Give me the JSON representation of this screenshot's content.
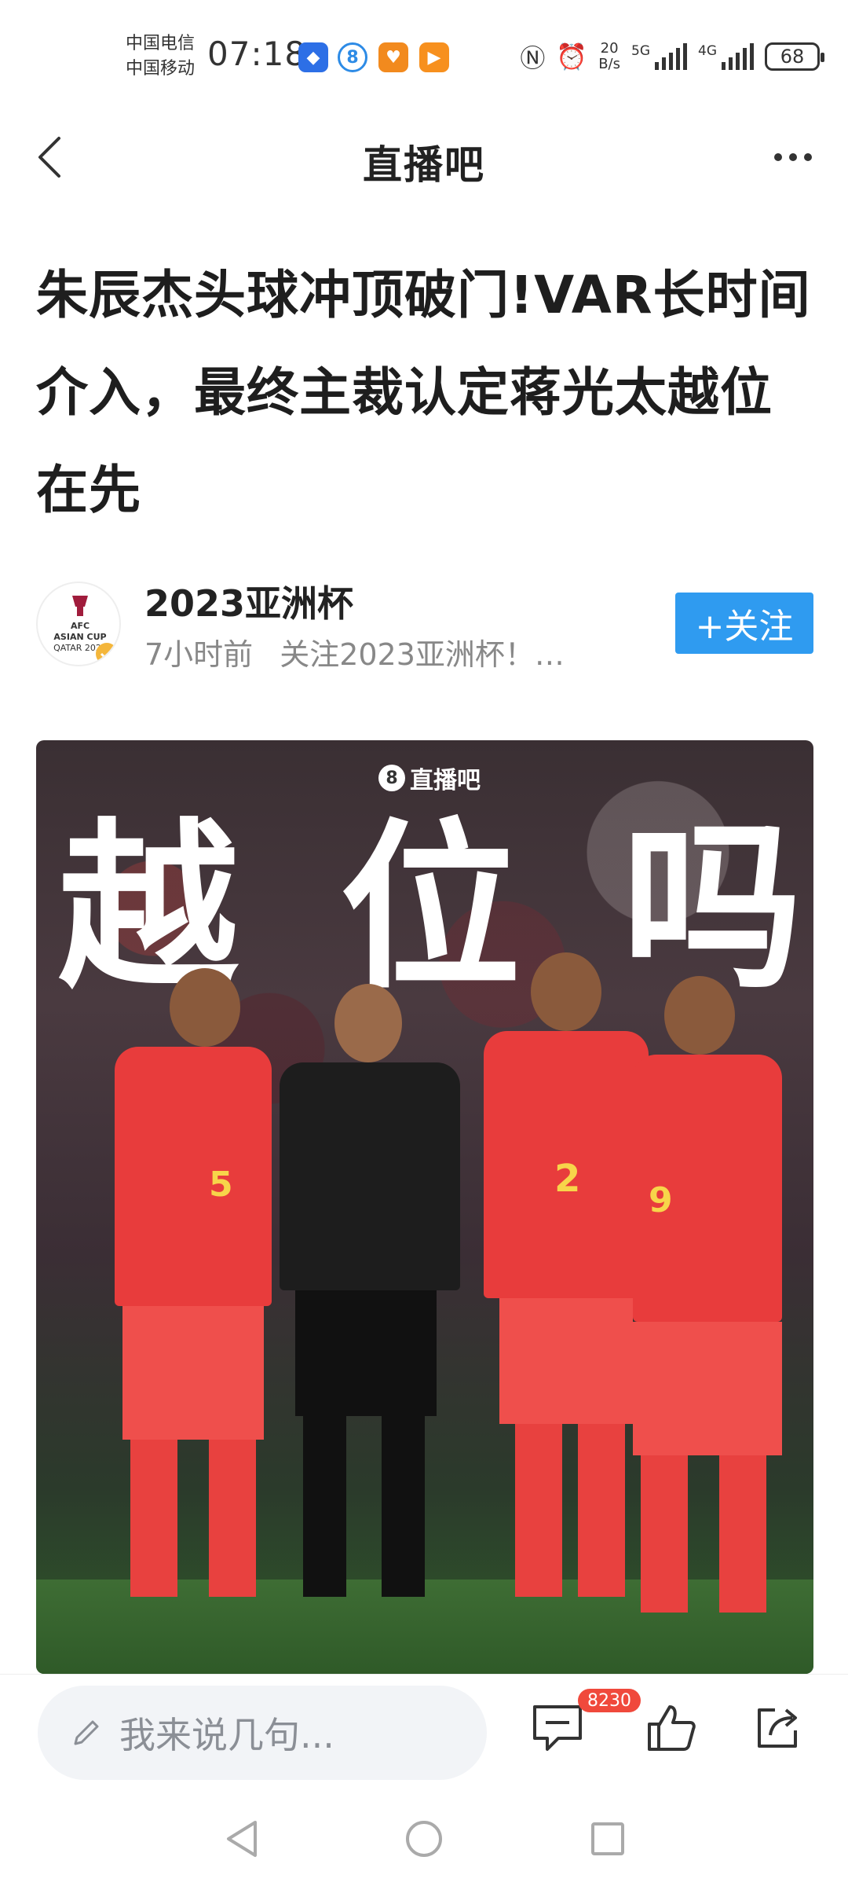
{
  "status_bar": {
    "carrier_1": "中国电信",
    "carrier_2": "中国移动",
    "time": "07:18",
    "net_speed_value": "20",
    "net_speed_unit": "B/s",
    "signal_1": "5G",
    "signal_2": "4G",
    "battery": "68",
    "notification_icons": [
      "blue-app-icon",
      "blue-circle-8-icon",
      "orange-app-icon",
      "orange-play-icon"
    ],
    "system_icons": [
      "nfc-icon",
      "alarm-icon"
    ]
  },
  "nav": {
    "title": "直播吧"
  },
  "article": {
    "title": "朱辰杰头球冲顶破门!VAR长时间介入，最终主裁认定蒋光太越位在先"
  },
  "author": {
    "name": "2023亚洲杯",
    "time_ago": "7小时前",
    "description": "关注2023亚洲杯！…",
    "follow_label": "+关注",
    "avatar_text_1": "AFC",
    "avatar_text_2": "ASIAN CUP",
    "avatar_text_3": "QATAR 2023"
  },
  "image": {
    "watermark_badge": "8",
    "watermark": "直播吧",
    "overlay_chars": [
      "越",
      "位",
      "吗"
    ],
    "jersey_numbers": [
      "5",
      "2",
      "9"
    ]
  },
  "actions": {
    "comment_placeholder": "我来说几句...",
    "comment_count": "8230"
  },
  "colors": {
    "follow_button": "#2f9bf0",
    "badge": "#f0493c"
  }
}
